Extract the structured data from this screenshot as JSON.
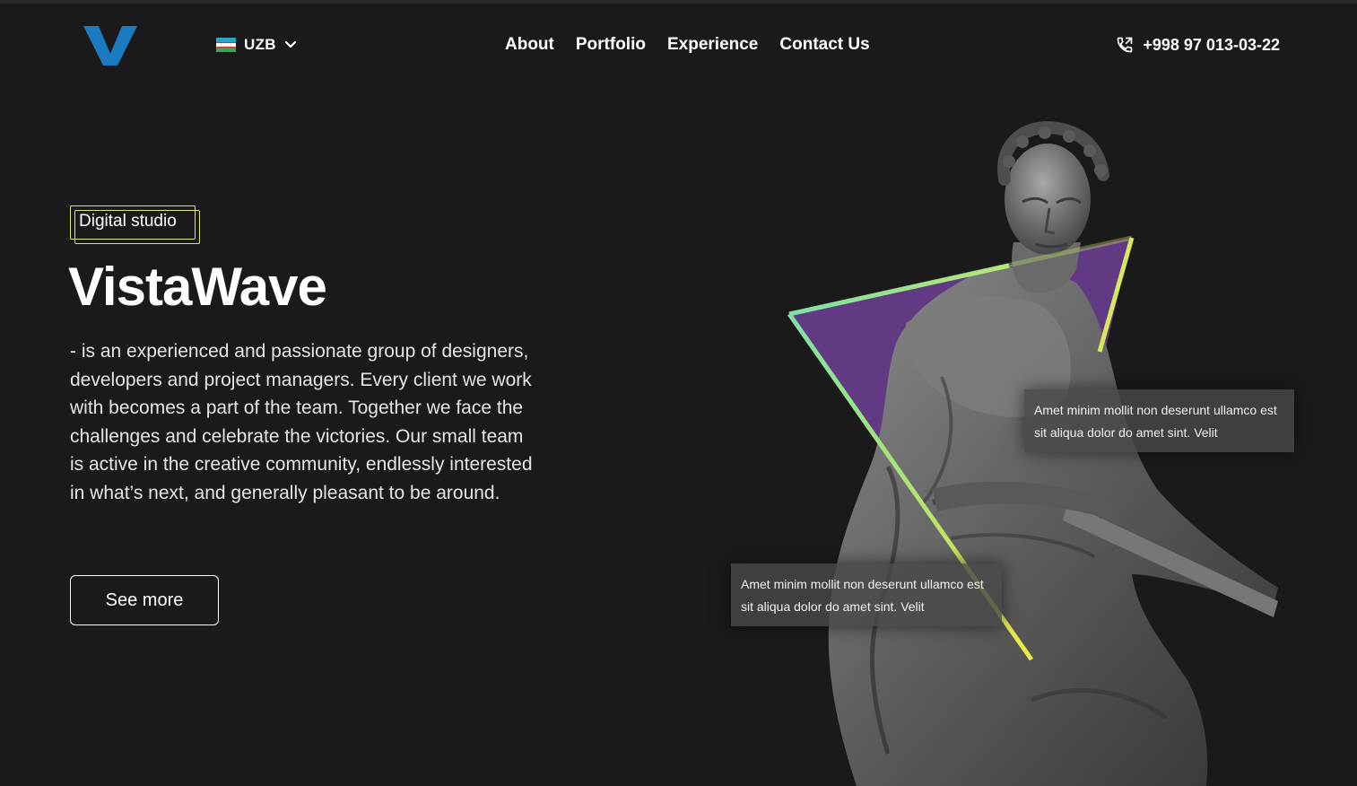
{
  "header": {
    "logo_letter": "V",
    "language": {
      "label": "UZB",
      "flag": "uzbekistan-flag-icon"
    },
    "nav": [
      {
        "label": "About"
      },
      {
        "label": "Portfolio"
      },
      {
        "label": "Experience"
      },
      {
        "label": "Contact Us"
      }
    ],
    "phone": {
      "icon": "phone-icon",
      "number": "+998 97 013-03-22"
    }
  },
  "hero": {
    "badge": "Digital studio",
    "title": "VistaWave",
    "description": "- is an experienced and passionate group of designers, developers and project managers. Every client we work with becomes a part of the team. Together we face the challenges and celebrate the victories. Our small team is active in the creative community, endlessly interested in what’s next, and generally pleasant to be around.",
    "cta_label": "See more"
  },
  "illustration": {
    "subject": "statue-image",
    "captions": [
      {
        "text": "Amet minim mollit non deserunt ullamco est sit aliqua dolor do amet sint. Velit"
      },
      {
        "text": "Amet minim mollit non deserunt ullamco est sit aliqua dolor do amet sint. Velit"
      }
    ]
  },
  "colors": {
    "background": "#1a1a1a",
    "logo_blue": "#1a7ac2",
    "badge_border": "#dfe86a",
    "triangle_fill": "#623a84",
    "triangle_stroke_start": "#7fe1a6",
    "triangle_stroke_end": "#f0ea45"
  }
}
